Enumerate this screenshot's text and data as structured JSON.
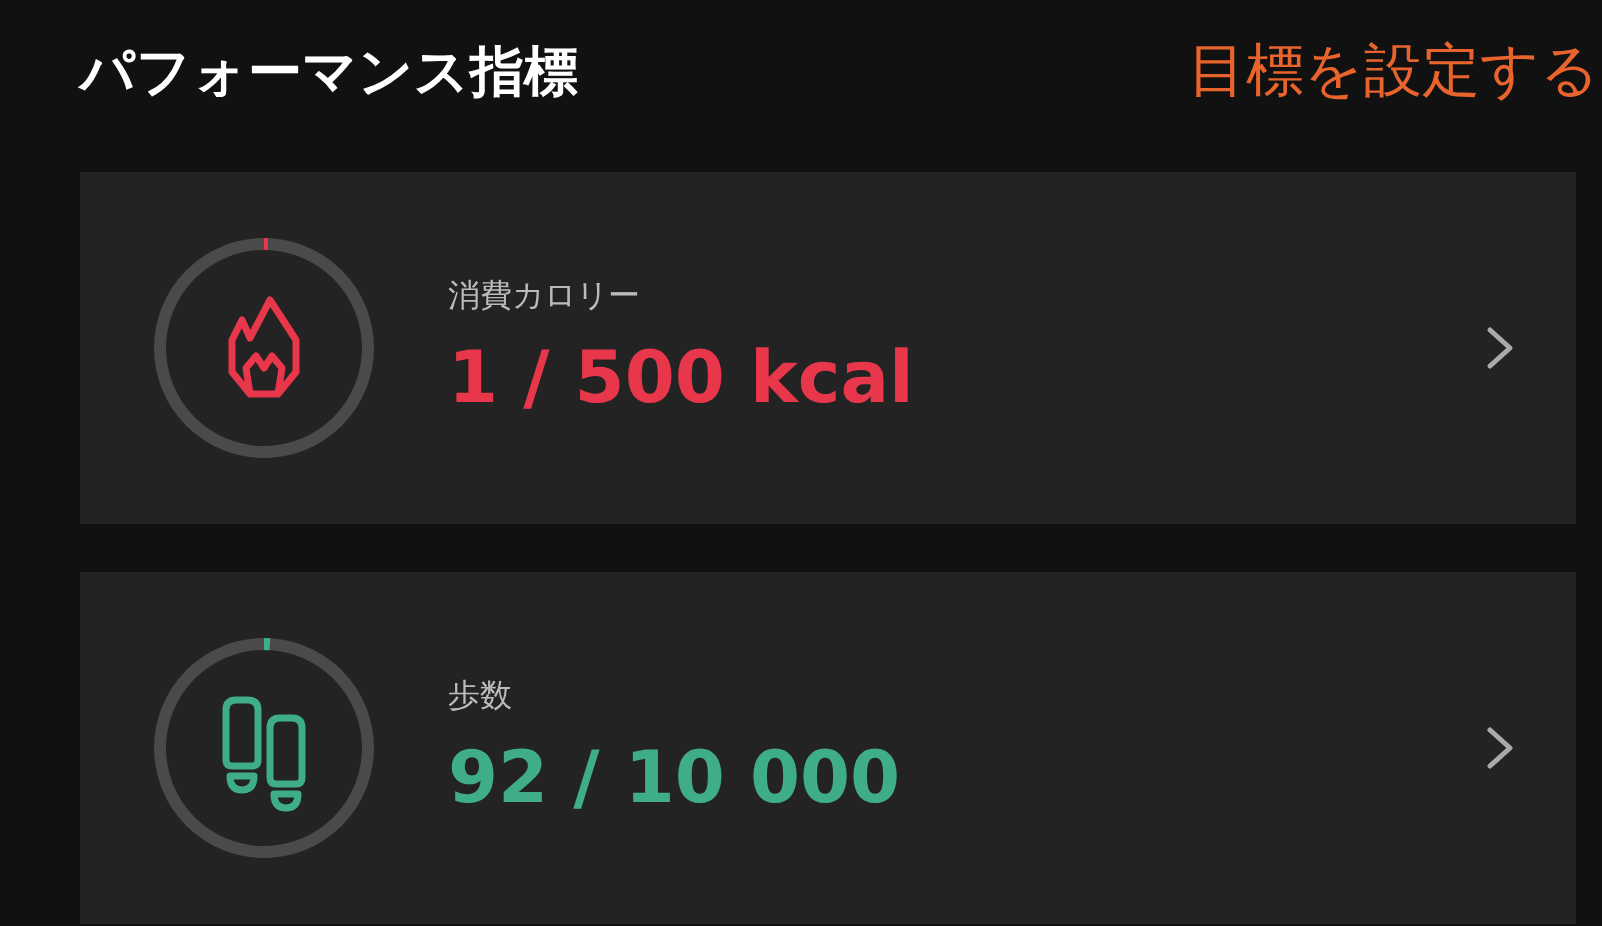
{
  "header": {
    "title": "パフォーマンス指標",
    "action": "目標を設定する"
  },
  "metrics": [
    {
      "kind": "calories",
      "label": "消費カロリー",
      "value": "1 / 500 kcal",
      "level": 0.002,
      "color": "#e8374a"
    },
    {
      "kind": "steps",
      "label": "歩数",
      "value": "92 / 10 000",
      "level": 0.0092,
      "color": "#3fae86"
    }
  ]
}
